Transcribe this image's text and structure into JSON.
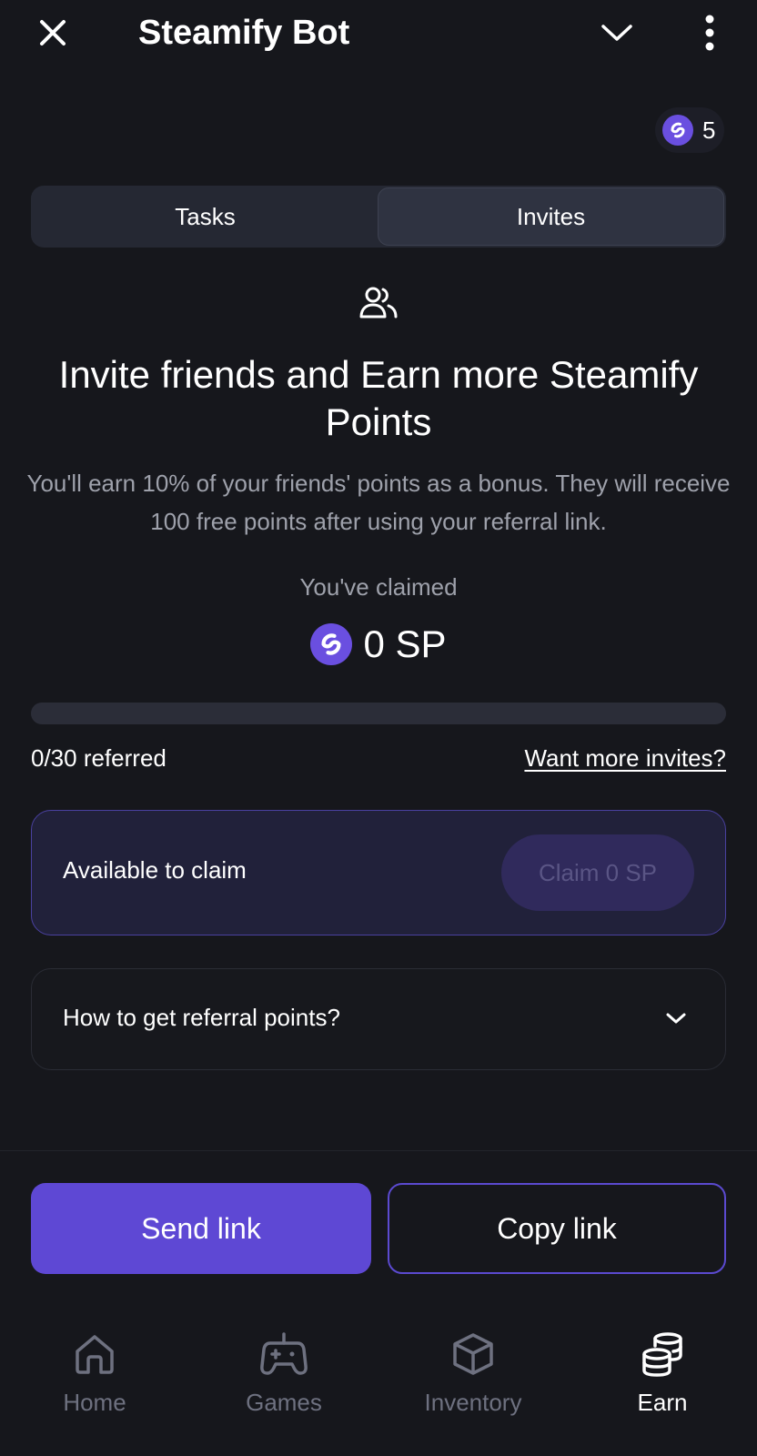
{
  "app": {
    "title": "Steamify Bot"
  },
  "balance": {
    "value": "5"
  },
  "tabs": [
    {
      "label": "Tasks",
      "active": false
    },
    {
      "label": "Invites",
      "active": true
    }
  ],
  "hero": {
    "icon": "people-icon",
    "headline": "Invite friends and Earn more Steamify Points",
    "subtext": "You'll earn 10% of your friends' points as a bonus. They will receive 100 free points after using your referral link."
  },
  "claimed": {
    "label": "You've claimed",
    "value": "0 SP"
  },
  "referrals": {
    "progress": 0,
    "referred_text": "0/30 referred",
    "more_link": "Want more invites?"
  },
  "claim_card": {
    "label": "Available to claim",
    "button": "Claim 0 SP"
  },
  "accordion": {
    "label": "How to get referral points?"
  },
  "actions": {
    "send": "Send link",
    "copy": "Copy link"
  },
  "nav": [
    {
      "label": "Home",
      "icon": "home-icon",
      "active": false
    },
    {
      "label": "Games",
      "icon": "gamepad-icon",
      "active": false
    },
    {
      "label": "Inventory",
      "icon": "box-icon",
      "active": false
    },
    {
      "label": "Earn",
      "icon": "coins-icon",
      "active": true
    }
  ],
  "colors": {
    "background": "#16171c",
    "accent": "#5e48d4",
    "coin": "#6a4fe0",
    "muted_text": "#9ea1ab"
  }
}
